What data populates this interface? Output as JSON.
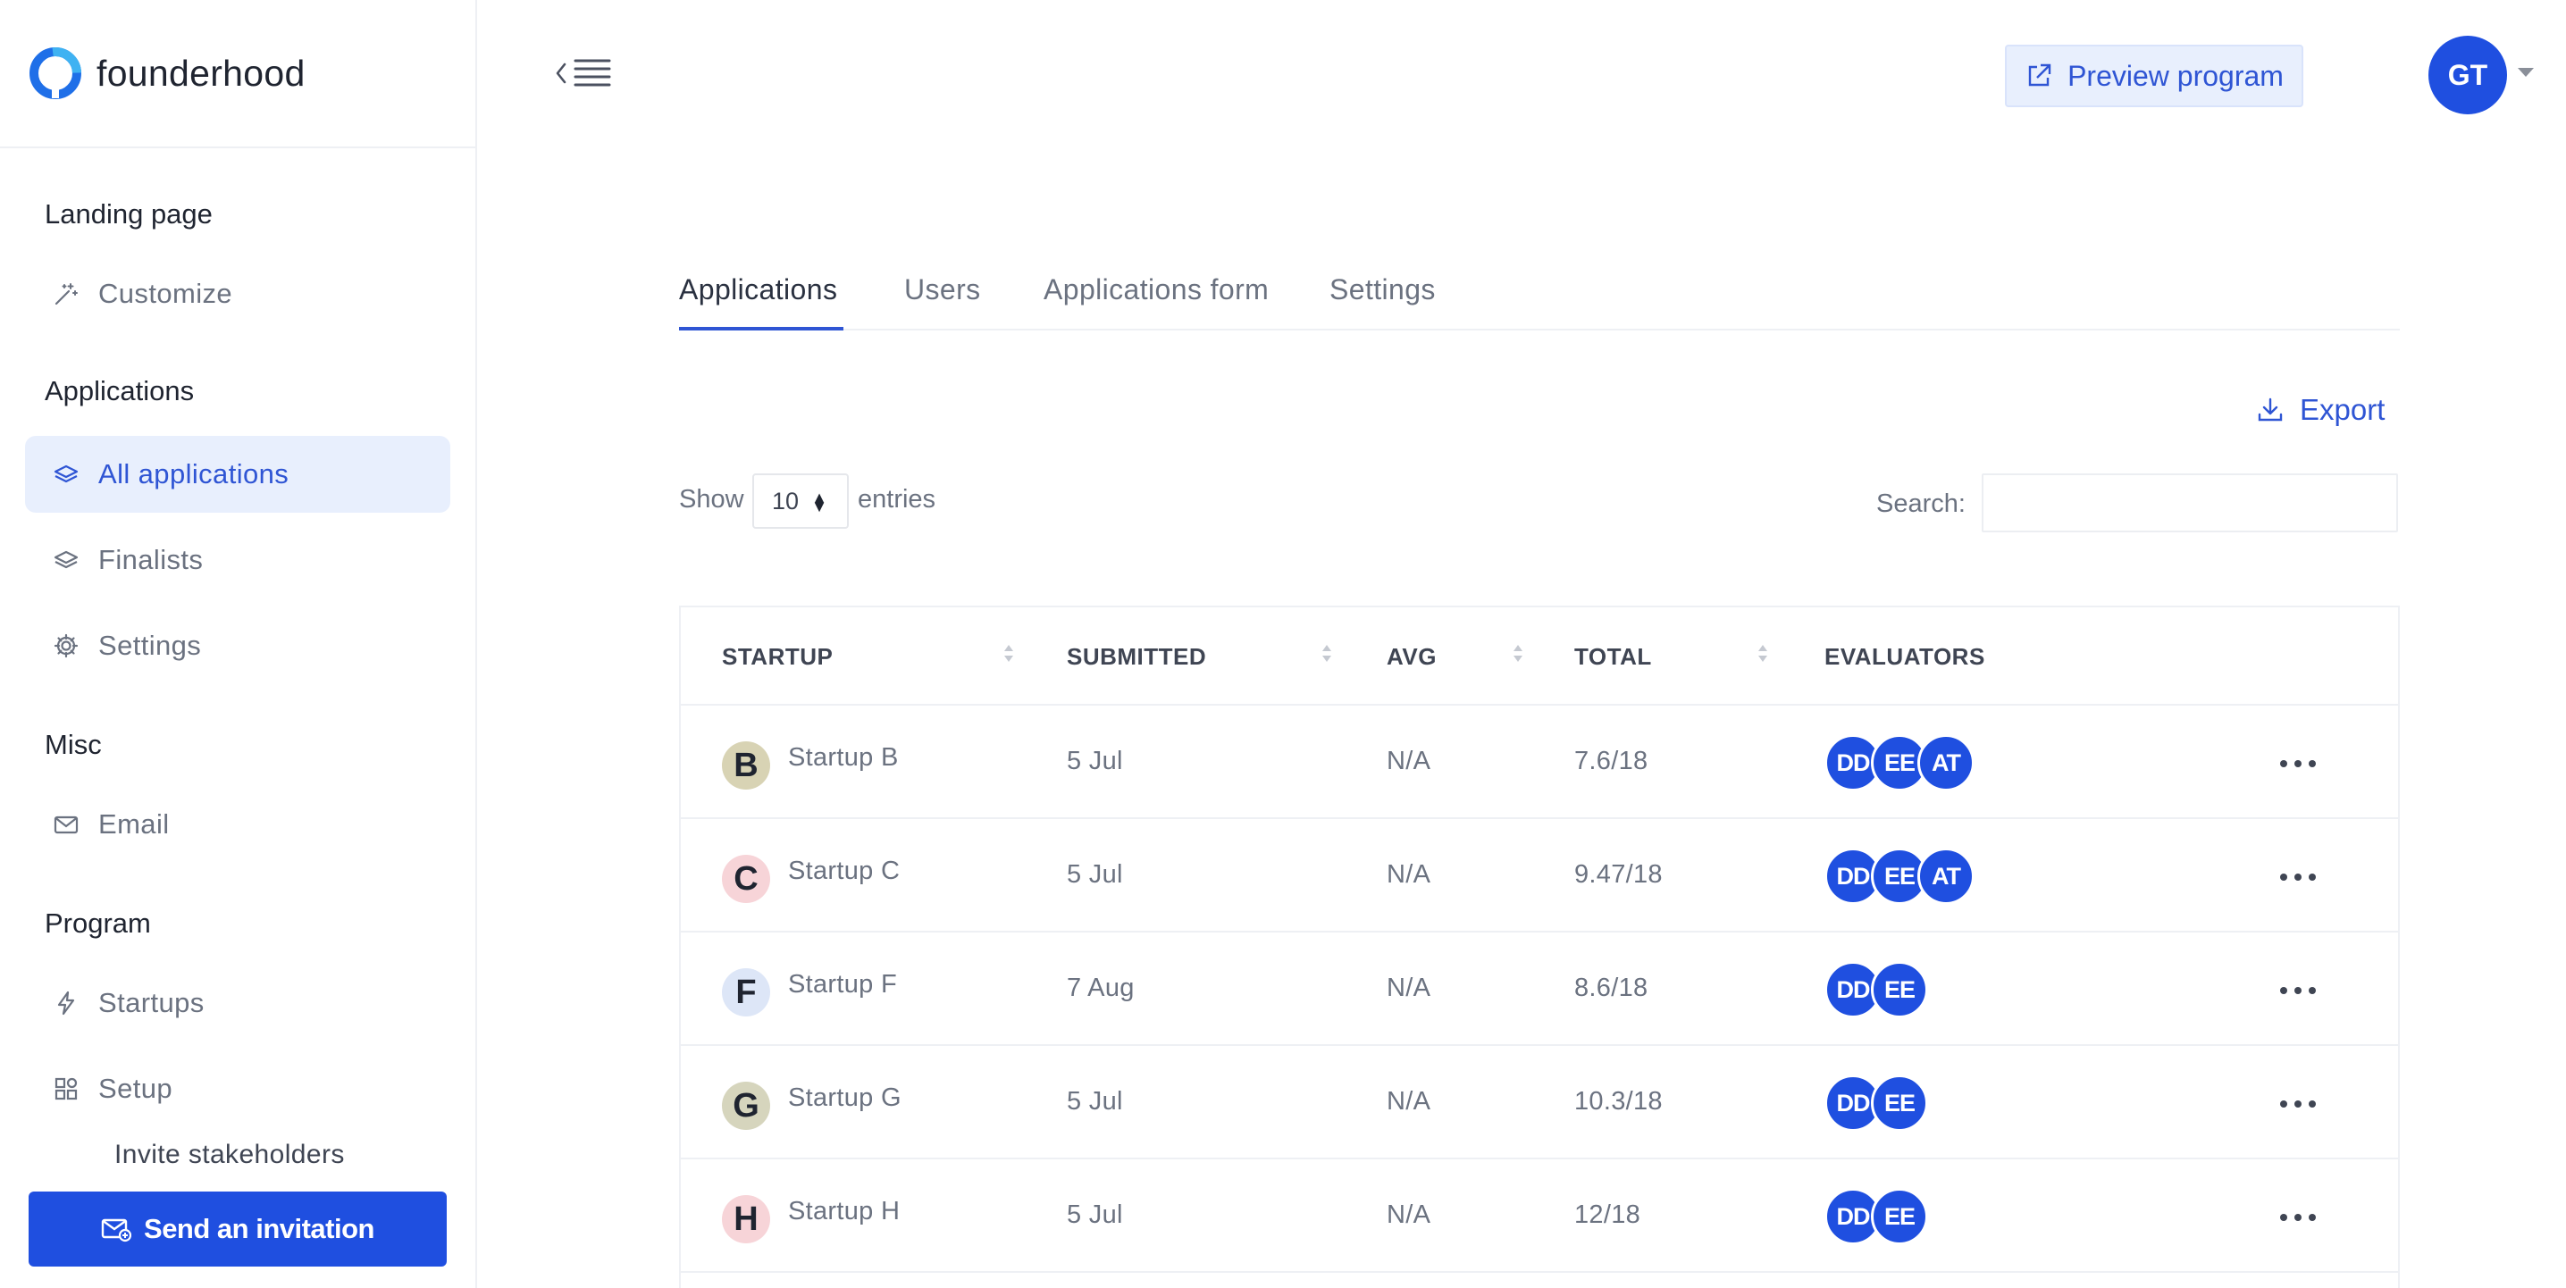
{
  "brand": {
    "name": "founderhood"
  },
  "sidebar": {
    "sections": {
      "landing": "Landing page",
      "applications": "Applications",
      "misc": "Misc",
      "program": "Program"
    },
    "items": {
      "customize": "Customize",
      "all_applications": "All applications",
      "finalists": "Finalists",
      "settings": "Settings",
      "email": "Email",
      "startups": "Startups",
      "setup": "Setup",
      "invite_stakeholders": "Invite stakeholders"
    },
    "invite_button": "Send an invitation"
  },
  "header": {
    "preview_button": "Preview program",
    "user_initials": "GT"
  },
  "tabs": [
    "Applications",
    "Users",
    "Applications form",
    "Settings"
  ],
  "controls": {
    "export_label": "Export",
    "show_label": "Show",
    "entries_value": "10",
    "entries_label": "entries",
    "search_label": "Search:",
    "search_value": ""
  },
  "table": {
    "columns": [
      "STARTUP",
      "SUBMITTED",
      "AVG",
      "TOTAL",
      "EVALUATORS"
    ],
    "rows": [
      {
        "letter": "B",
        "name": "Startup B",
        "submitted": "5 Jul",
        "avg": "N/A",
        "total": "7.6/18",
        "evaluators": [
          "DD",
          "EE",
          "AT"
        ]
      },
      {
        "letter": "C",
        "name": "Startup C",
        "submitted": "5 Jul",
        "avg": "N/A",
        "total": "9.47/18",
        "evaluators": [
          "DD",
          "EE",
          "AT"
        ]
      },
      {
        "letter": "F",
        "name": "Startup F",
        "submitted": "7 Aug",
        "avg": "N/A",
        "total": "8.6/18",
        "evaluators": [
          "DD",
          "EE"
        ]
      },
      {
        "letter": "G",
        "name": "Startup G",
        "submitted": "5 Jul",
        "avg": "N/A",
        "total": "10.3/18",
        "evaluators": [
          "DD",
          "EE"
        ]
      },
      {
        "letter": "H",
        "name": "Startup H",
        "submitted": "5 Jul",
        "avg": "N/A",
        "total": "12/18",
        "evaluators": [
          "DD",
          "EE"
        ]
      }
    ]
  },
  "colors": {
    "accent": "#1f4fe0",
    "accent_text": "#2f55d4",
    "active_bg": "#e8effd",
    "letter_b": "#d8d3b4",
    "letter_c": "#f7d4d8",
    "letter_f": "#dde6f7",
    "letter_g": "#d6d5bd",
    "letter_h": "#f7d4d8"
  }
}
